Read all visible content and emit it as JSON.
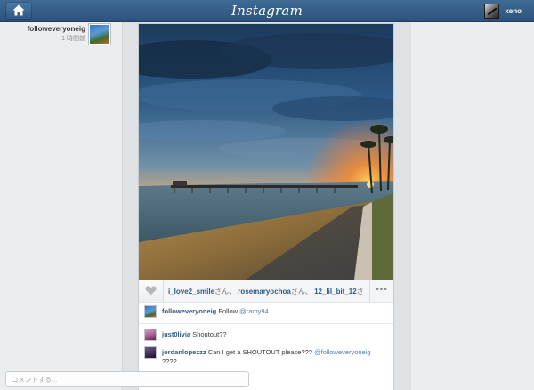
{
  "app": {
    "logo_text": "Instagram"
  },
  "header": {
    "username": "xeno"
  },
  "post": {
    "author": "followeveryoneig",
    "time": "1 時間前",
    "likes": {
      "users": [
        "i_love2_smile",
        "rosemaryochoa",
        "12_lil_bit_12"
      ],
      "suffix": "さん、",
      "more_label": "•••"
    },
    "caption": {
      "user": "followeveryoneig",
      "text": "Follow ",
      "mention": "@ramy94"
    },
    "comments": [
      {
        "user": "just0livia",
        "text": "Shoutout??"
      },
      {
        "user": "jordanlopezzz",
        "text": "Can I get a SHOUTOUT please??? ",
        "mention": "@followeveryoneig",
        "text_after": "????"
      }
    ],
    "comment_placeholder": "コメントする..."
  },
  "colors": {
    "topbar": "#2c527b",
    "link": "#2f5a84",
    "background": "#eceeef"
  }
}
